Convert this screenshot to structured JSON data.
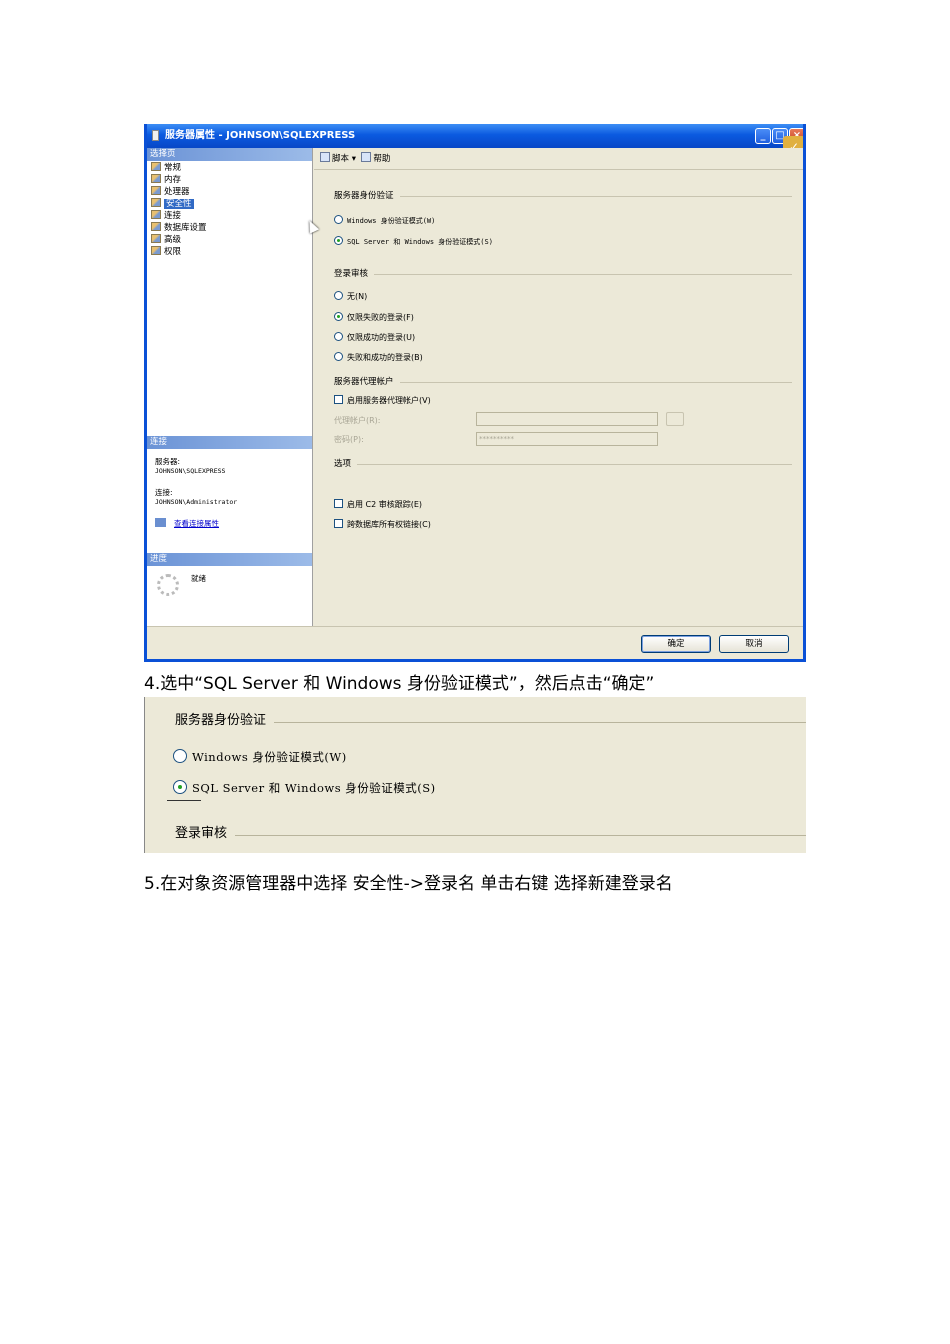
{
  "dialog": {
    "title": "服务器属性 - JOHNSON\\SQLEXPRESS",
    "select_page_header": "选择页",
    "nav_items": [
      "常规",
      "内存",
      "处理器",
      "安全性",
      "连接",
      "数据库设置",
      "高级",
      "权限"
    ],
    "selected_nav": "安全性",
    "connection_header": "连接",
    "server_label": "服务器:",
    "server_value": "JOHNSON\\SQLEXPRESS",
    "connection_label": "连接:",
    "connection_value": "JOHNSON\\Administrator",
    "view_props_link": "查看连接属性",
    "progress_header": "进度",
    "progress_status": "就绪",
    "toolbar": {
      "script": "脚本",
      "help": "帮助"
    },
    "auth_group": "服务器身份验证",
    "auth_windows": "Windows 身份验证模式(W)",
    "auth_mixed": "SQL Server 和 Windows 身份验证模式(S)",
    "audit_group": "登录审核",
    "audit_none": "无(N)",
    "audit_failed": "仅限失败的登录(F)",
    "audit_success": "仅限成功的登录(U)",
    "audit_both": "失败和成功的登录(B)",
    "proxy_group": "服务器代理帐户",
    "proxy_enable": "启用服务器代理帐户(V)",
    "proxy_account_label": "代理帐户(R):",
    "proxy_password_label": "密码(P):",
    "proxy_password_value": "**********",
    "options_group": "选项",
    "opt_c2": "启用 C2 审核跟踪(E)",
    "opt_cross_db": "跨数据库所有权链接(C)",
    "ok_button": "确定",
    "cancel_button": "取消",
    "selected_auth": "mixed",
    "selected_audit": "failed"
  },
  "step4_text": "4.选中“SQL Server 和 Windows 身份验证模式”，然后点击“确定”",
  "zoom": {
    "auth_group": "服务器身份验证",
    "auth_windows": "Windows 身份验证模式(W)",
    "auth_mixed": "SQL Server 和 Windows 身份验证模式(S)",
    "audit_group": "登录审核"
  },
  "step5_text": "5.在对象资源管理器中选择 安全性->登录名 单击右键 选择新建登录名"
}
